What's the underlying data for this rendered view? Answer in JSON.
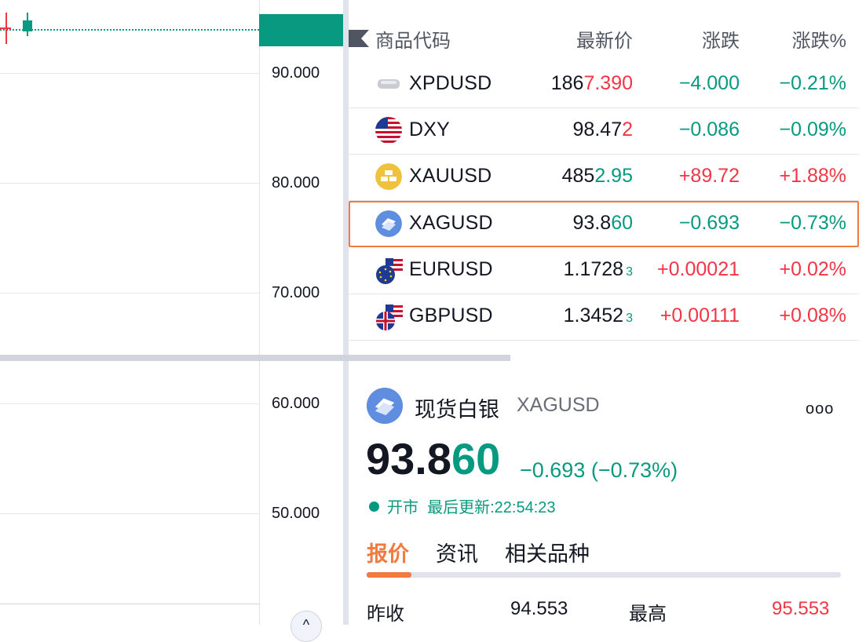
{
  "chart": {
    "price_ticks": [
      "90.000",
      "80.000",
      "70.000",
      "60.000",
      "50.000"
    ],
    "expand_glyph": "^"
  },
  "watchlist": {
    "headers": {
      "symbol": "商品代码",
      "last": "最新价",
      "change": "涨跌",
      "change_pct": "涨跌%"
    },
    "rows": [
      {
        "symbol": "XPDUSD",
        "last_a": "186",
        "last_b": "7.390",
        "last_sub": "",
        "change": "−4.000",
        "change_pct": "−0.21%",
        "icon": "palladium-icon",
        "highlight_color": "#f23645",
        "dir": "down",
        "selected": false
      },
      {
        "symbol": "DXY",
        "last_a": "98.47",
        "last_b": "2",
        "last_sub": "",
        "change": "−0.086",
        "change_pct": "−0.09%",
        "icon": "us-flag-icon",
        "highlight_color": "#f23645",
        "dir": "down",
        "selected": false
      },
      {
        "symbol": "XAUUSD",
        "last_a": "485",
        "last_b": "2.95",
        "last_sub": "",
        "change": "+89.72",
        "change_pct": "+1.88%",
        "icon": "gold-icon",
        "highlight_color": "#089981",
        "dir": "up",
        "selected": false
      },
      {
        "symbol": "XAGUSD",
        "last_a": "93.8",
        "last_b": "60",
        "last_sub": "",
        "change": "−0.693",
        "change_pct": "−0.73%",
        "icon": "silver-icon",
        "highlight_color": "#089981",
        "dir": "down",
        "selected": true
      },
      {
        "symbol": "EURUSD",
        "last_a": "1.1728",
        "last_b": "",
        "last_sub": "3",
        "change": "+0.00021",
        "change_pct": "+0.02%",
        "icon": "eu-us-flag-icon",
        "highlight_color": "#089981",
        "dir": "up",
        "selected": false
      },
      {
        "symbol": "GBPUSD",
        "last_a": "1.3452",
        "last_b": "",
        "last_sub": "3",
        "change": "+0.00111",
        "change_pct": "+0.08%",
        "icon": "uk-us-flag-icon",
        "highlight_color": "#089981",
        "dir": "up",
        "selected": false
      }
    ]
  },
  "details": {
    "name": "现货白银",
    "symbol": "XAGUSD",
    "more": "ooo",
    "price_a": "93.8",
    "price_b": "60",
    "change": "−0.693 (−0.73%)",
    "status": "开市",
    "last_update": "最后更新:22:54:23",
    "tabs": [
      "报价",
      "资讯",
      "相关品种"
    ],
    "prev_close_label": "昨收",
    "prev_close": "94.553",
    "high_label": "最高",
    "high": "95.553"
  },
  "colors": {
    "up": "#f23645",
    "down": "#089981",
    "accent": "#f07a3f"
  }
}
